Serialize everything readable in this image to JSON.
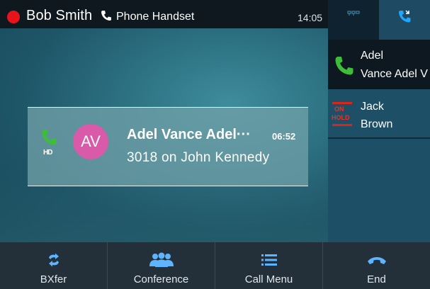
{
  "status_bar": {
    "user_name": "Bob Smith",
    "audio_device": "Phone Handset",
    "time": "14:05",
    "presence_color": "#e8141c"
  },
  "tabs": [
    {
      "icon": "contacts-icon",
      "active": false
    },
    {
      "icon": "calls-icon",
      "active": true
    }
  ],
  "call_list": [
    {
      "line1": "Adel",
      "line2": "Vance Adel V",
      "state": "active",
      "icon": "phone-green-icon"
    },
    {
      "line1": "Jack",
      "line2": "Brown",
      "state": "hold",
      "badge_top": "ON",
      "badge_bottom": "HOLD"
    }
  ],
  "active_call": {
    "initials": "AV",
    "name": "Adel Vance Adel···",
    "duration": "06:52",
    "number": "3018  on John Kennedy",
    "hd_label": "HD",
    "avatar_color": "#d85aa8"
  },
  "softkeys": [
    {
      "label": "BXfer",
      "icon": "transfer-icon"
    },
    {
      "label": "Conference",
      "icon": "conference-icon"
    },
    {
      "label": "Call Menu",
      "icon": "menu-icon"
    },
    {
      "label": "End",
      "icon": "hangup-icon"
    }
  ]
}
